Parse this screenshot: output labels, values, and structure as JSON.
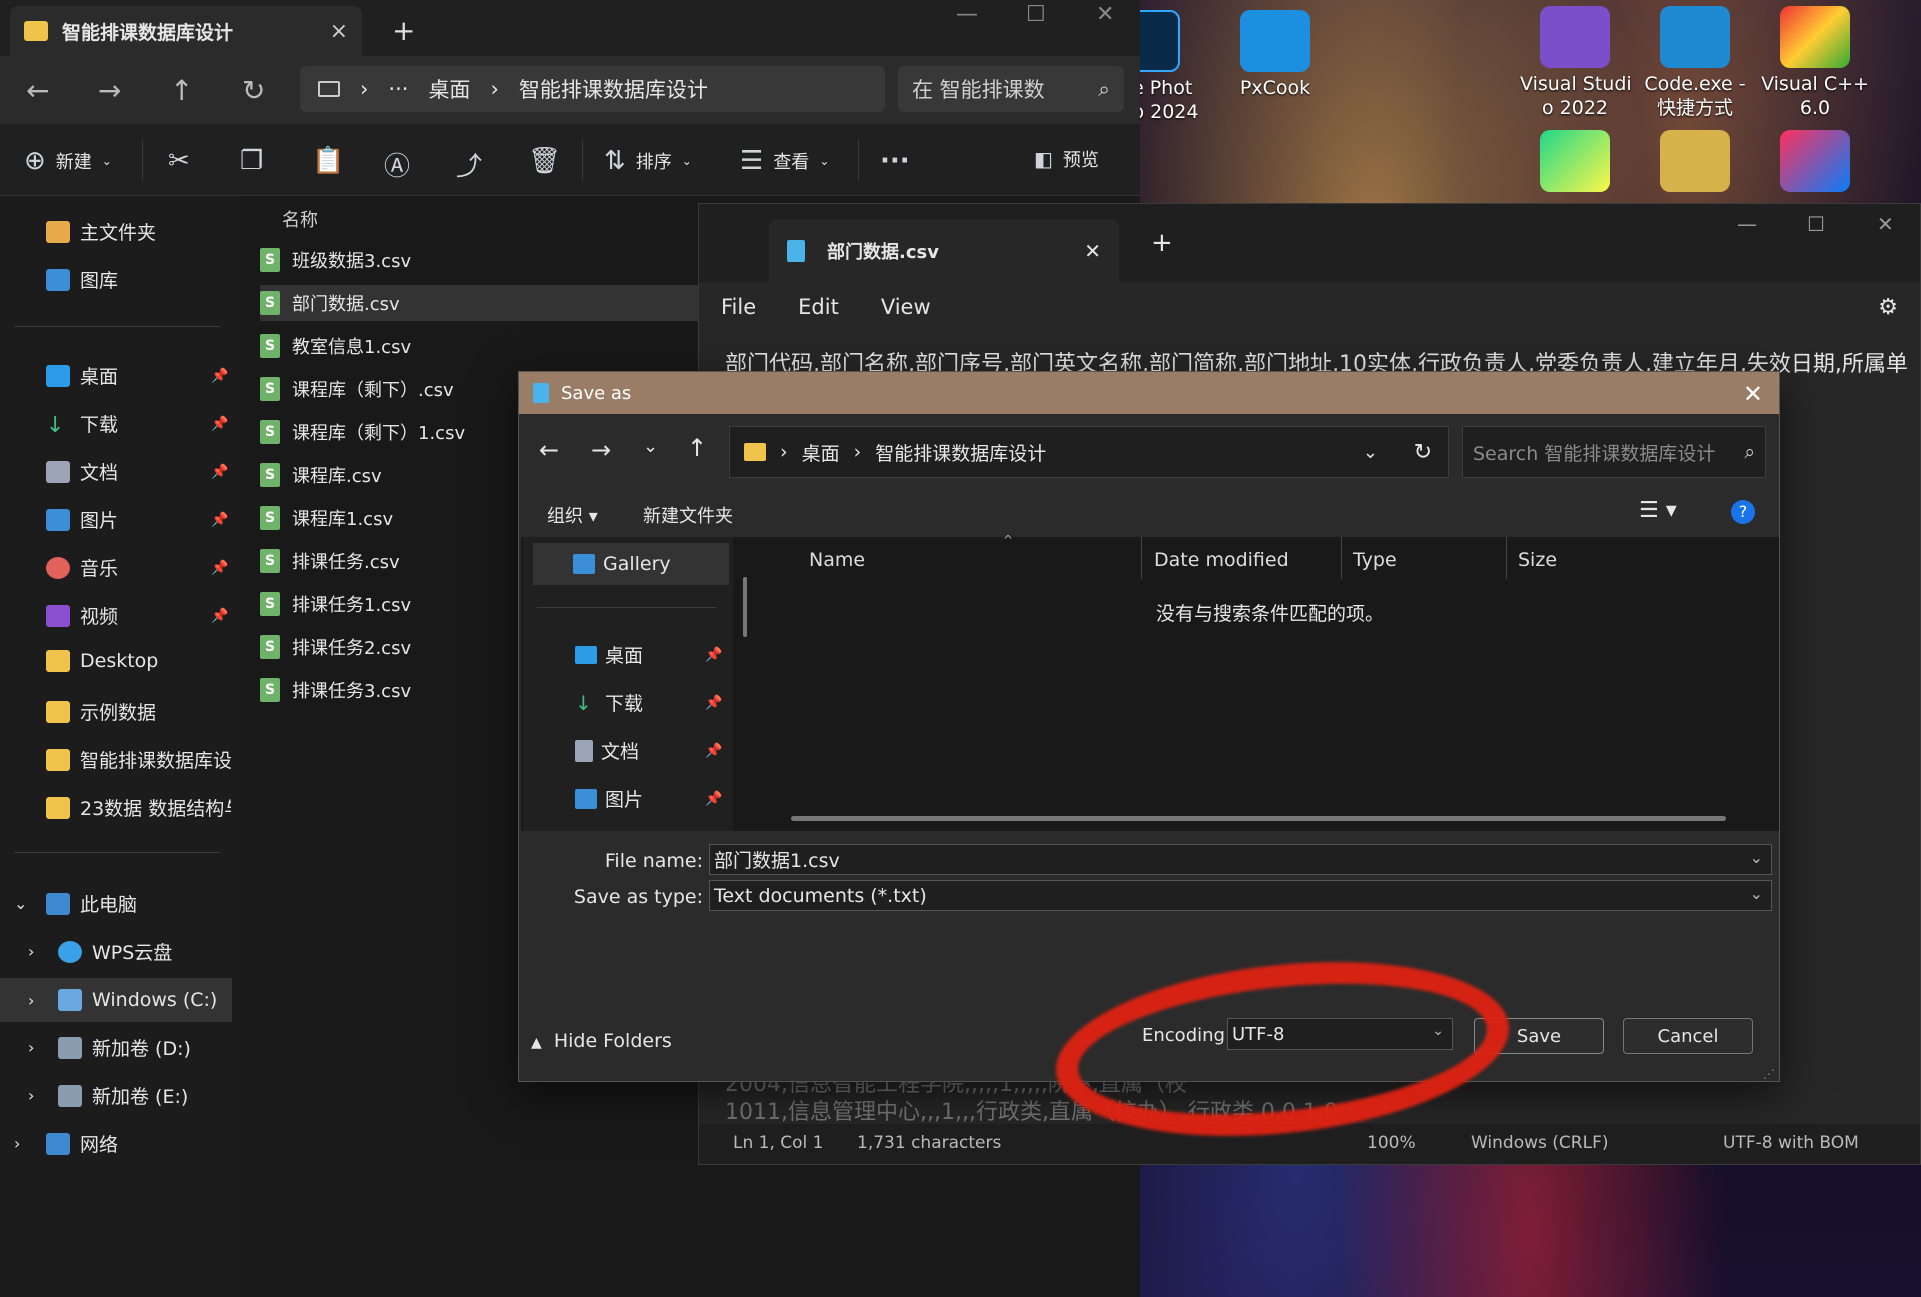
{
  "explorer": {
    "tab_title": "智能排课数据库设计",
    "tab_close": "×",
    "new_tab": "+",
    "address": {
      "seg1": "桌面",
      "seg2": "智能排课数据库设计",
      "more": "···",
      "sep": "›"
    },
    "search_placeholder": "在 智能排课数",
    "commands": {
      "new": "新建",
      "sort": "排序",
      "view": "查看",
      "more": "···",
      "preview": "预览"
    },
    "column_name": "名称",
    "nav": {
      "home": "主文件夹",
      "gallery": "图库",
      "desktop": "桌面",
      "downloads": "下载",
      "documents": "文档",
      "pictures": "图片",
      "music": "音乐",
      "videos": "视频",
      "desktop_en": "Desktop",
      "sample_data": "示例数据",
      "project": "智能排课数据库设计",
      "ds": "23数据 数据结构与",
      "this_pc": "此电脑",
      "wps": "WPS云盘",
      "c_drive": "Windows  (C:)",
      "d_drive": "新加卷 (D:)",
      "e_drive": "新加卷 (E:)",
      "network": "网络"
    },
    "files": [
      "班级数据3.csv",
      "部门数据.csv",
      "教室信息1.csv",
      "课程库（剩下）.csv",
      "课程库（剩下）1.csv",
      "课程库.csv",
      "课程库1.csv",
      "排课任务.csv",
      "排课任务1.csv",
      "排课任务2.csv",
      "排课任务3.csv"
    ]
  },
  "desktop_icons": {
    "ps": "e Phot\np 2024",
    "pxcook": "PxCook",
    "vs": "Visual Studi\no 2022",
    "code": "Code.exe -\n快捷方式",
    "vc": "Visual C++\n6.0"
  },
  "notepad": {
    "tab_title": "部门数据.csv",
    "menu": {
      "file": "File",
      "edit": "Edit",
      "view": "View"
    },
    "line1": "部门代码,部门名称,部门序号,部门英文名称,部门简称,部门地址,10实体,行政负责人,党委负责人,建立年月,失效日期,所属单",
    "line_partial1": "2004,信息智能工程学院,,,,,1,,,,,院系,直属（校",
    "line_partial2": "1011,信息管理中心,,,1,,,行政类,直属（校办）,行政类,0,0,1,0",
    "status": {
      "pos": "Ln 1, Col 1",
      "chars": "1,731 characters",
      "zoom": "100%",
      "eol": "Windows (CRLF)",
      "enc": "UTF-8 with BOM"
    }
  },
  "dialog": {
    "title": "Save as",
    "address": {
      "seg1": "桌面",
      "seg2": "智能排课数据库设计"
    },
    "search_placeholder": "Search 智能排课数据库设计",
    "organize": "组织",
    "new_folder": "新建文件夹",
    "left": {
      "gallery": "Gallery",
      "desktop": "桌面",
      "downloads": "下载",
      "documents": "文档",
      "pictures": "图片"
    },
    "columns": {
      "name": "Name",
      "date": "Date modified",
      "type": "Type",
      "size": "Size"
    },
    "empty": "没有与搜索条件匹配的项。",
    "filename_label": "File name:",
    "filename_value": "部门数据1.csv",
    "type_label": "Save as type:",
    "type_value": "Text documents (*.txt)",
    "hide_folders": "Hide Folders",
    "encoding_label": "Encoding:",
    "encoding_value": "UTF-8",
    "save": "Save",
    "cancel": "Cancel"
  }
}
